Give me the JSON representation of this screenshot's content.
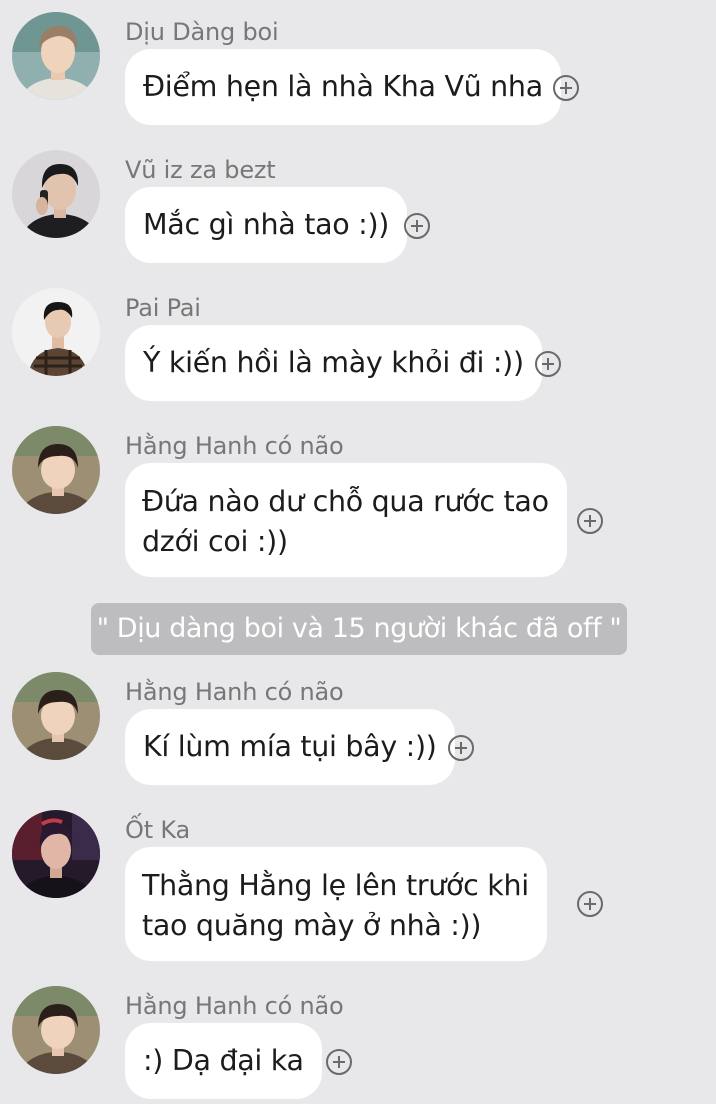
{
  "chat": {
    "messages": [
      {
        "sender": "Dịu Dàng boi",
        "avatar": "avatar-light-hair-boy",
        "lines": [
          "Điểm hẹn là nhà Kha Vũ nha"
        ]
      },
      {
        "sender": "Vũ iz za bezt",
        "avatar": "avatar-phone-call-boy",
        "lines": [
          "Mắc gì nhà tao :))"
        ]
      },
      {
        "sender": "Pai Pai",
        "avatar": "avatar-plaid-jacket-boy",
        "lines": [
          "Ý kiến hồi là mày khỏi đi :))"
        ]
      },
      {
        "sender": "Hằng Hanh có não",
        "avatar": "avatar-smiling-boy",
        "lines": [
          "Đứa nào dư chỗ qua rước tao",
          "dzới coi :))"
        ]
      },
      {
        "sender": "Hằng Hanh có não",
        "avatar": "avatar-smiling-boy",
        "lines": [
          "Kí lùm mía tụi bây :))"
        ]
      },
      {
        "sender": "Ốt Ka",
        "avatar": "avatar-red-light-boy",
        "lines": [
          "Thằng Hằng lẹ lên trước khi",
          "tao quăng mày ở nhà :))"
        ]
      },
      {
        "sender": "Hằng Hanh có não",
        "avatar": "avatar-smiling-boy",
        "lines": [
          ":) Dạ đại ka"
        ]
      }
    ],
    "system_notice": "\" Dịu dàng boi và 15 người khác đã off \"",
    "react_icon": "add-reaction-icon"
  }
}
